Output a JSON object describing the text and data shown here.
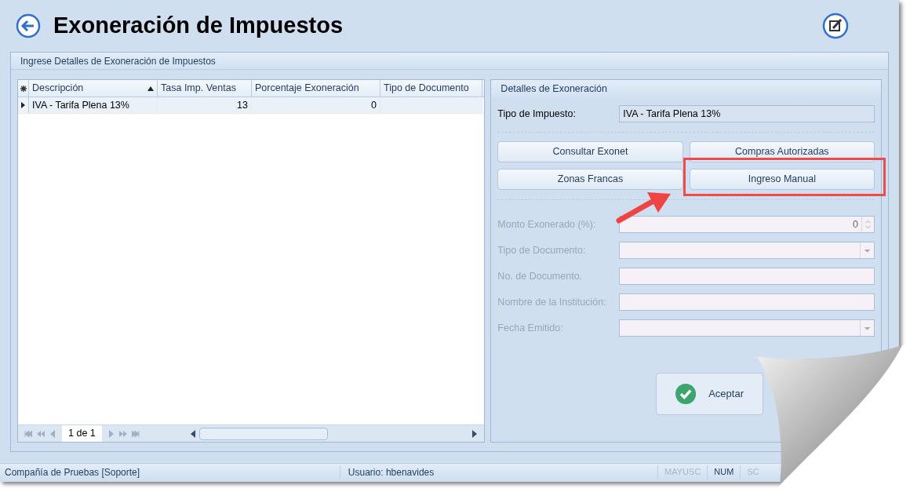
{
  "window": {
    "title": "Exoneración de Impuestos"
  },
  "group_title": "Ingrese Detalles de Exoneración de Impuestos",
  "grid": {
    "columns": [
      {
        "label": "Descripción",
        "sorted": true
      },
      {
        "label": "Tasa Imp. Ventas",
        "sorted": false
      },
      {
        "label": "Porcentaje Exoneración",
        "sorted": false
      },
      {
        "label": "Tipo de Documento",
        "sorted": false
      }
    ],
    "rows": [
      {
        "selected": true,
        "cells": [
          "IVA - Tarifa Plena 13%",
          "13",
          "0",
          ""
        ]
      }
    ],
    "pager": "1 de 1"
  },
  "details": {
    "title": "Detalles de Exoneración",
    "tax_label": "Tipo de Impuesto:",
    "tax_value": "IVA - Tarifa Plena 13%",
    "buttons": [
      {
        "label": "Consultar Exonet",
        "highlighted": false
      },
      {
        "label": "Compras Autorizadas",
        "highlighted": false
      },
      {
        "label": "Zonas Francas",
        "highlighted": false
      },
      {
        "label": "Ingreso Manual",
        "highlighted": true
      }
    ],
    "fields": [
      {
        "label": "Monto Exonerado (%):",
        "kind": "spin",
        "value": "0",
        "disabled": true
      },
      {
        "label": "Tipo de Documento:",
        "kind": "combo",
        "disabled": true
      },
      {
        "label": "No. de Documento.",
        "kind": "text",
        "disabled": true
      },
      {
        "label": "Nombre de la Institución:",
        "kind": "text",
        "disabled": true
      },
      {
        "label": "Fecha Emitido:",
        "kind": "combo",
        "disabled": true
      }
    ],
    "accept": "Aceptar"
  },
  "status_bar": {
    "company": "Compañía de Pruebas [Soporte]",
    "user": "Usuario: hbenavides",
    "indicators": [
      {
        "label": "MAYUSC",
        "active": false
      },
      {
        "label": "NUM",
        "active": true
      },
      {
        "label": "SC",
        "active": false
      }
    ]
  }
}
